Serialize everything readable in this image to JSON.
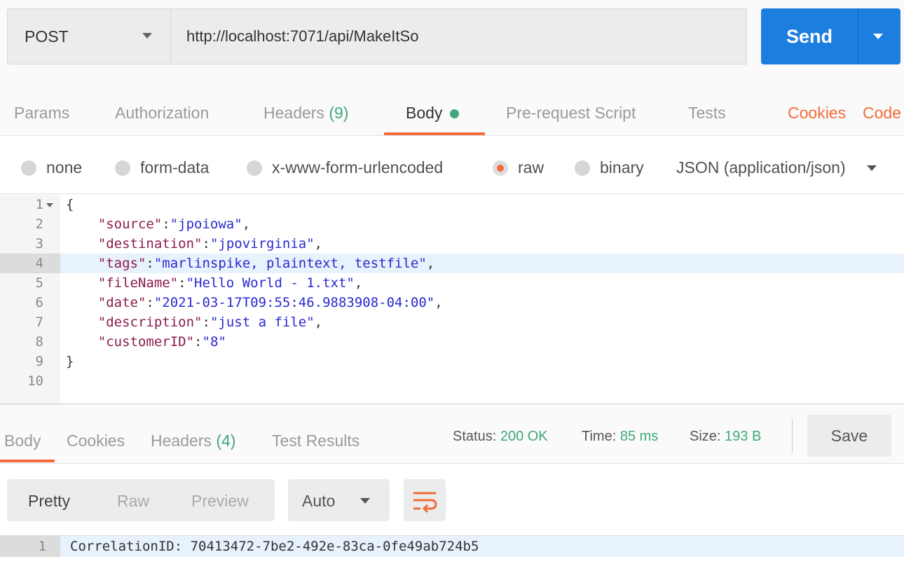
{
  "request": {
    "method": "POST",
    "url": "http://localhost:7071/api/MakeItSo",
    "send_label": "Send"
  },
  "request_tabs": {
    "params": "Params",
    "authorization": "Authorization",
    "headers": "Headers",
    "headers_count": "(9)",
    "body": "Body",
    "prerequest": "Pre-request Script",
    "tests": "Tests",
    "cookies": "Cookies",
    "code": "Code"
  },
  "body_types": {
    "none": "none",
    "form_data": "form-data",
    "urlencoded": "x-www-form-urlencoded",
    "raw": "raw",
    "binary": "binary",
    "content_type": "JSON (application/json)"
  },
  "request_body_lines": [
    {
      "n": "1",
      "tokens": [
        [
          "p",
          "{"
        ]
      ]
    },
    {
      "n": "2",
      "tokens": [
        [
          "p",
          "    "
        ],
        [
          "k",
          "\"source\""
        ],
        [
          "p",
          ":"
        ],
        [
          "v",
          "\"jpoiowa\""
        ],
        [
          "p",
          ","
        ]
      ]
    },
    {
      "n": "3",
      "tokens": [
        [
          "p",
          "    "
        ],
        [
          "k",
          "\"destination\""
        ],
        [
          "p",
          ":"
        ],
        [
          "v",
          "\"jpovirginia\""
        ],
        [
          "p",
          ","
        ]
      ]
    },
    {
      "n": "4",
      "tokens": [
        [
          "p",
          "    "
        ],
        [
          "k",
          "\"tags\""
        ],
        [
          "p",
          ":"
        ],
        [
          "v",
          "\"marlinspike, plaintext, testfile\""
        ],
        [
          "p",
          ","
        ]
      ]
    },
    {
      "n": "5",
      "tokens": [
        [
          "p",
          "    "
        ],
        [
          "k",
          "\"fileName\""
        ],
        [
          "p",
          ":"
        ],
        [
          "v",
          "\"Hello World - 1.txt\""
        ],
        [
          "p",
          ","
        ]
      ]
    },
    {
      "n": "6",
      "tokens": [
        [
          "p",
          "    "
        ],
        [
          "k",
          "\"date\""
        ],
        [
          "p",
          ":"
        ],
        [
          "v",
          "\"2021-03-17T09:55:46.9883908-04:00\""
        ],
        [
          "p",
          ","
        ]
      ]
    },
    {
      "n": "7",
      "tokens": [
        [
          "p",
          "    "
        ],
        [
          "k",
          "\"description\""
        ],
        [
          "p",
          ":"
        ],
        [
          "v",
          "\"just a file\""
        ],
        [
          "p",
          ","
        ]
      ]
    },
    {
      "n": "8",
      "tokens": [
        [
          "p",
          "    "
        ],
        [
          "k",
          "\"customerID\""
        ],
        [
          "p",
          ":"
        ],
        [
          "v",
          "\"8\""
        ]
      ]
    },
    {
      "n": "9",
      "tokens": [
        [
          "p",
          "}"
        ]
      ]
    },
    {
      "n": "10",
      "tokens": []
    }
  ],
  "response_tabs": {
    "body": "Body",
    "cookies": "Cookies",
    "headers": "Headers",
    "headers_count": "(4)",
    "test_results": "Test Results"
  },
  "response_status": {
    "status_label": "Status:",
    "status": "200 OK",
    "time_label": "Time:",
    "time": "85 ms",
    "size_label": "Size:",
    "size": "193 B",
    "save": "Save"
  },
  "response_format": {
    "pretty": "Pretty",
    "raw": "Raw",
    "preview": "Preview",
    "auto": "Auto"
  },
  "response_body_lines": [
    {
      "n": "1",
      "text": "CorrelationID: 70413472-7be2-492e-83ca-0fe49ab724b5"
    }
  ],
  "colors": {
    "accent": "#f26b3a",
    "send": "#1c7fe0",
    "success": "#3ea87a"
  }
}
